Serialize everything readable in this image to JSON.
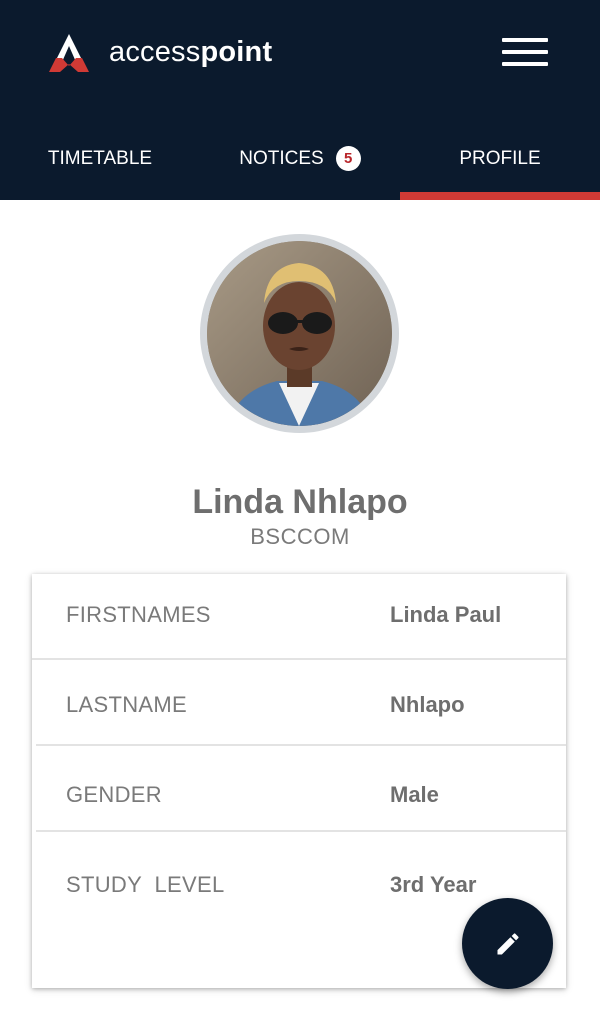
{
  "header": {
    "logo_icon": "accesspoint-logo",
    "brand_light": "access",
    "brand_bold": "point",
    "menu_icon": "hamburger-menu-icon"
  },
  "tabs": [
    {
      "label": "TIMETABLE",
      "active": false
    },
    {
      "label": "NOTICES",
      "active": false,
      "badge": "5"
    },
    {
      "label": "PROFILE",
      "active": true
    }
  ],
  "profile": {
    "name": "Linda Nhlapo",
    "course": "BSCCOM",
    "avatar_icon": "profile-photo"
  },
  "details": [
    {
      "label": "FIRSTNAMES",
      "value": "Linda Paul"
    },
    {
      "label": "LASTNAME",
      "value": "Nhlapo"
    },
    {
      "label": "GENDER",
      "value": "Male"
    },
    {
      "label": "STUDY  LEVEL",
      "value": "3rd Year"
    }
  ],
  "fab": {
    "icon": "edit-pencil-icon"
  },
  "colors": {
    "header_bg": "#0b1a2d",
    "accent": "#d03a35",
    "badge_text": "#b8252a",
    "text_gray": "#7a7a7a"
  }
}
